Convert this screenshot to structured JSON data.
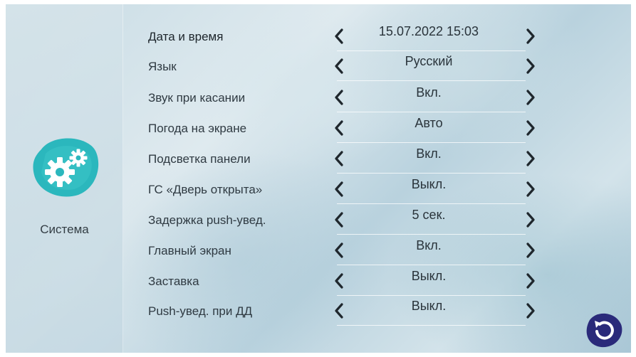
{
  "sidebar": {
    "section_label": "Система",
    "icon": "gears-icon",
    "icon_color": "#2bb7bd"
  },
  "settings": [
    {
      "label": "Дата и время",
      "value": "15.07.2022  15:03"
    },
    {
      "label": "Язык",
      "value": "Русский"
    },
    {
      "label": "Звук при касании",
      "value": "Вкл."
    },
    {
      "label": "Погода на экране",
      "value": "Авто"
    },
    {
      "label": "Подсветка панели",
      "value": "Вкл."
    },
    {
      "label": "ГС  «Дверь открыта»",
      "value": "Выкл."
    },
    {
      "label": "Задержка push-увед.",
      "value": "5 сек."
    },
    {
      "label": "Главный экран",
      "value": "Вкл."
    },
    {
      "label": "Заставка",
      "value": "Выкл."
    },
    {
      "label": "Push-увед. при ДД",
      "value": "Выкл."
    }
  ],
  "controls": {
    "prev_icon": "chevron-left-icon",
    "next_icon": "chevron-right-icon",
    "back_icon": "back-arrow-icon",
    "back_button_color": "#2a2a7a"
  }
}
